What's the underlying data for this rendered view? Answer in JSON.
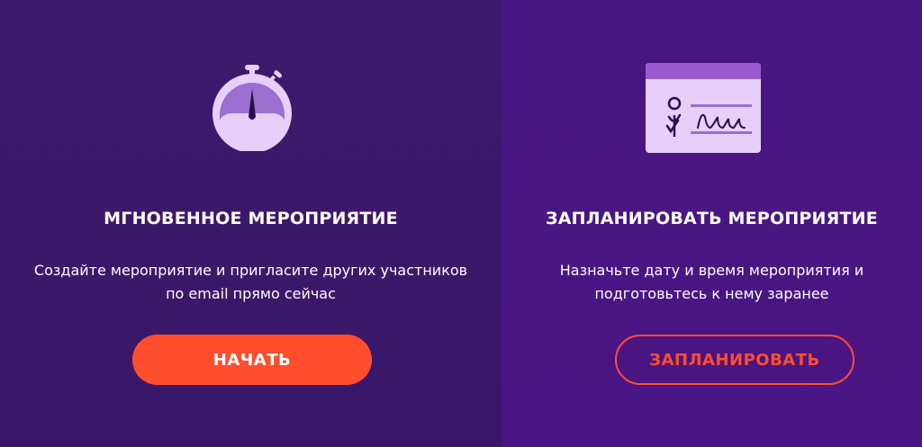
{
  "instant": {
    "title": "МГНОВЕННОЕ МЕРОПРИЯТИЕ",
    "description_line1": "Создайте мероприятие и пригласите других участников",
    "description_line2": "по email прямо сейчас",
    "button_label": "НАЧАТЬ",
    "icon": "stopwatch-icon"
  },
  "scheduled": {
    "title": "ЗАПЛАНИРОВАТЬ МЕРОПРИЯТИЕ",
    "description_line1": "Назначьте дату и время мероприятия и",
    "description_line2": "подготовьтесь к нему заранее",
    "button_label": "ЗАПЛАНИРОВАТЬ",
    "icon": "signed-document-icon"
  },
  "colors": {
    "left_background": "#3e1a6e",
    "right_background": "#481680",
    "accent": "#ff4e2c",
    "icon_light": "#e6cff8",
    "icon_mid": "#9a6fd0"
  }
}
